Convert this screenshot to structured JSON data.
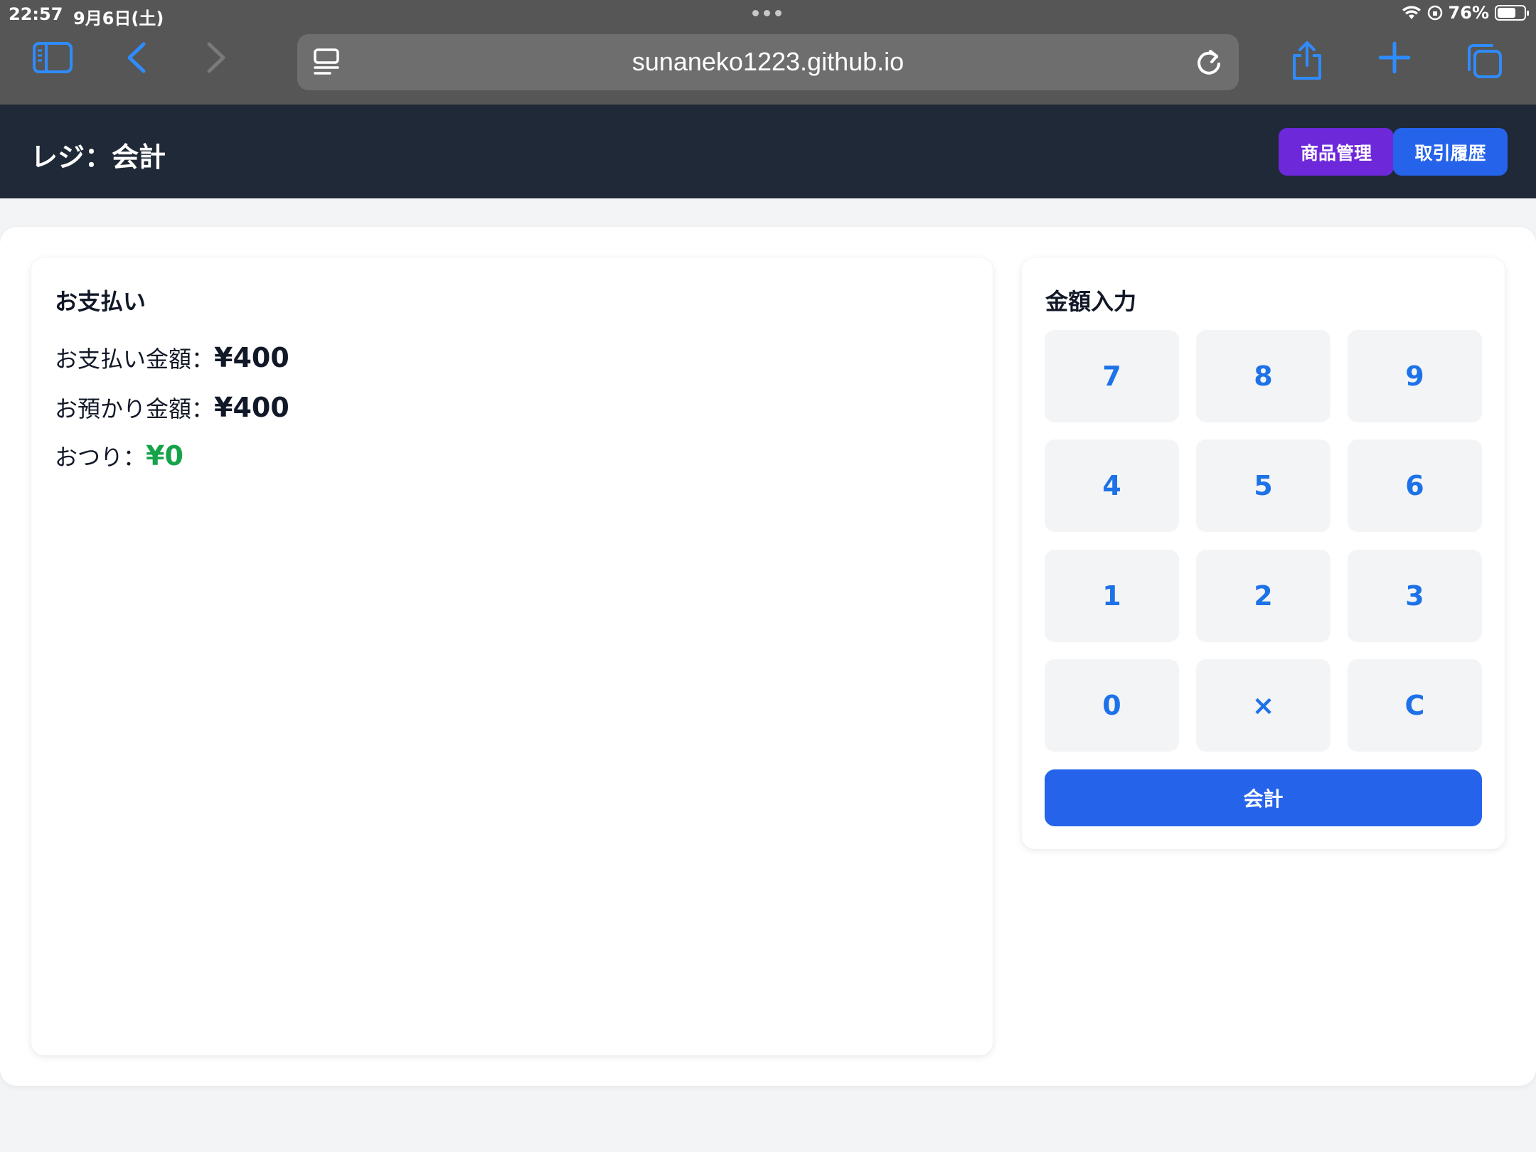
{
  "status_bar": {
    "time": "22:57",
    "date": "9月6日(土)",
    "battery": "76%"
  },
  "browser": {
    "url": "sunaneko1223.github.io"
  },
  "header": {
    "title": "レジ：会計",
    "products_button": "商品管理",
    "history_button": "取引履歴"
  },
  "payment": {
    "title": "お支払い",
    "amount_label": "お支払い金額：",
    "amount_value": "¥400",
    "received_label": "お預かり金額：",
    "received_value": "¥400",
    "change_label": "おつり：",
    "change_value": "¥0"
  },
  "keypad": {
    "title": "金額入力",
    "keys": [
      "7",
      "8",
      "9",
      "4",
      "5",
      "6",
      "1",
      "2",
      "3",
      "0",
      "×",
      "C"
    ],
    "checkout_label": "会計"
  },
  "colors": {
    "header_bg": "#1f2937",
    "products_button": "#6d28d9",
    "history_button": "#2563eb",
    "key_text": "#1d72e8",
    "change_value": "#16a34a",
    "checkout_button": "#2563eb"
  }
}
